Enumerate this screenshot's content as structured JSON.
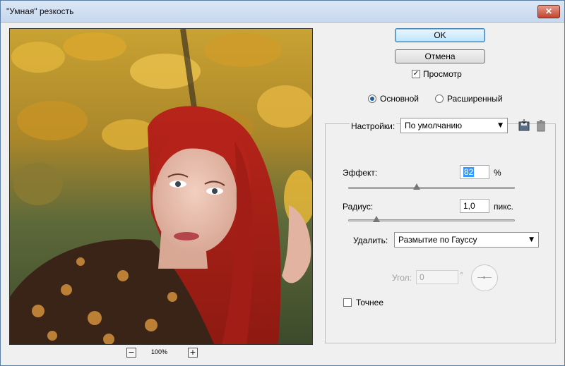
{
  "window": {
    "title": "\"Умная\" резкость",
    "close_glyph": "✕"
  },
  "preview": {
    "zoom_minus": "−",
    "zoom_plus": "+",
    "zoom_level": "100%"
  },
  "buttons": {
    "ok": "OK",
    "cancel": "Отмена"
  },
  "preview_checkbox": {
    "label": "Просмотр",
    "checked": true,
    "mark": "✓"
  },
  "mode": {
    "basic": "Основной",
    "advanced": "Расширенный",
    "selected": "basic"
  },
  "settings": {
    "label": "Настройки:",
    "value": "По умолчанию",
    "save_icon": "floppy-disk-icon",
    "delete_icon": "trash-icon"
  },
  "amount": {
    "label": "Эффект:",
    "value": "82",
    "unit": "%",
    "level": 0.41
  },
  "radius": {
    "label": "Радиус:",
    "value": "1,0",
    "unit": "пикс.",
    "level": 0.17
  },
  "remove": {
    "label": "Удалить:",
    "value": "Размытие по Гауссу"
  },
  "angle": {
    "label": "Угол:",
    "value": "0",
    "unit": "°"
  },
  "more_accurate": {
    "label": "Точнее",
    "checked": false
  },
  "dropdown_arrow": "▼"
}
